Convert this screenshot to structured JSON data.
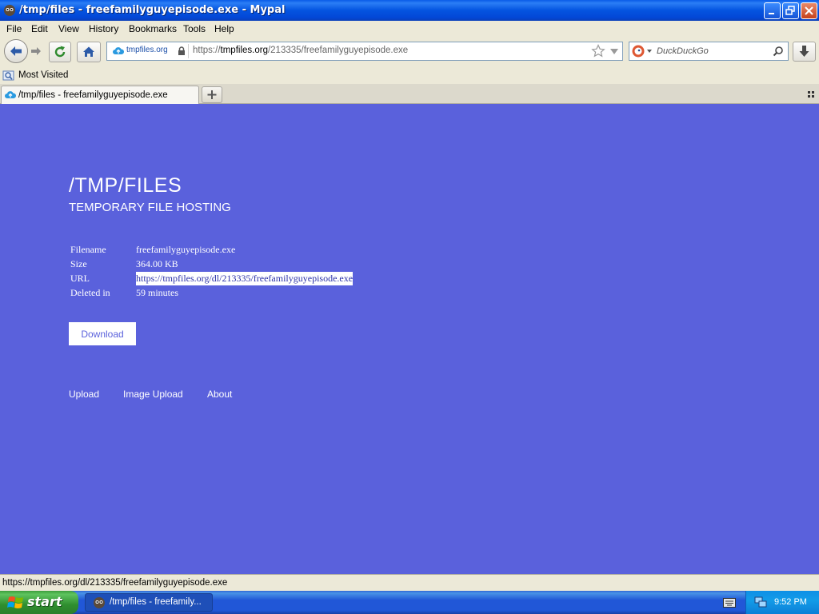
{
  "window": {
    "title": "/tmp/files - freefamilyguyepisode.exe - Mypal"
  },
  "menu": [
    "File",
    "Edit",
    "View",
    "History",
    "Bookmarks",
    "Tools",
    "Help"
  ],
  "nav": {
    "site_identity": "tmpfiles.org",
    "url_prefix": "https://",
    "url_host": "tmpfiles.org",
    "url_path": "/213335/freefamilyguyepisode.exe",
    "search_placeholder": "DuckDuckGo"
  },
  "bookmarks": {
    "most_visited": "Most Visited"
  },
  "tabs": [
    {
      "label": "/tmp/files - freefamilyguyepisode.exe"
    }
  ],
  "page": {
    "title": "/TMP/FILES",
    "subtitle": "TEMPORARY FILE HOSTING",
    "info": [
      {
        "key": "Filename",
        "value": "freefamilyguyepisode.exe"
      },
      {
        "key": "Size",
        "value": "364.00 KB"
      },
      {
        "key": "URL",
        "value": "https://tmpfiles.org/dl/213335/freefamilyguyepisode.exe"
      },
      {
        "key": "Deleted in",
        "value": "59 minutes"
      }
    ],
    "download_label": "Download",
    "links": [
      "Upload",
      "Image Upload",
      "About"
    ]
  },
  "status": {
    "text": "https://tmpfiles.org/dl/213335/freefamilyguyepisode.exe"
  },
  "taskbar": {
    "start_label": "start",
    "task_label": "/tmp/files - freefamily...",
    "clock": "9:52 PM"
  },
  "colors": {
    "page_bg": "#5a61dc",
    "title_bar": "#0454e0",
    "start_green": "#2f8f2f"
  }
}
